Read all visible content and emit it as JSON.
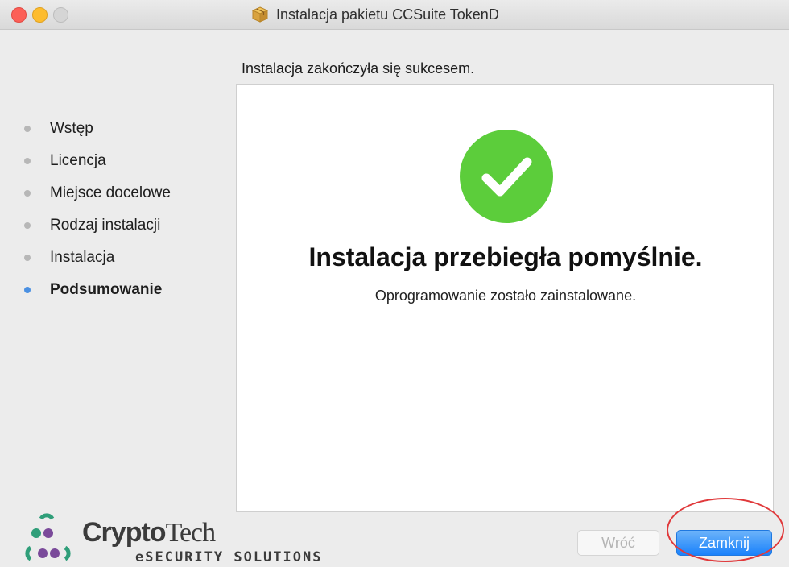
{
  "window": {
    "title": "Instalacja pakietu CCSuite TokenD",
    "icon": "package-icon"
  },
  "header": {
    "text": "Instalacja zakończyła się sukcesem."
  },
  "steps": [
    {
      "label": "Wstęp",
      "active": false
    },
    {
      "label": "Licencja",
      "active": false
    },
    {
      "label": "Miejsce docelowe",
      "active": false
    },
    {
      "label": "Rodzaj instalacji",
      "active": false
    },
    {
      "label": "Instalacja",
      "active": false
    },
    {
      "label": "Podsumowanie",
      "active": true
    }
  ],
  "main": {
    "icon": "checkmark-success-icon",
    "title": "Instalacja przebiegła pomyślnie.",
    "subtitle": "Oprogramowanie zostało zainstalowane."
  },
  "logo": {
    "brand_bold": "Crypto",
    "brand_regular": "Tech",
    "tagline": "eSECURITY SOLUTIONS"
  },
  "buttons": {
    "back": {
      "label": "Wróć",
      "enabled": false
    },
    "close": {
      "label": "Zamknij",
      "enabled": true
    }
  },
  "colors": {
    "success_green": "#5ccd3b",
    "accent_blue": "#1a82fb",
    "step_active_dot": "#4a90e2",
    "annotation_red": "#e0393b",
    "logo_green": "#2f9e79",
    "logo_purple": "#7a4a9a"
  }
}
